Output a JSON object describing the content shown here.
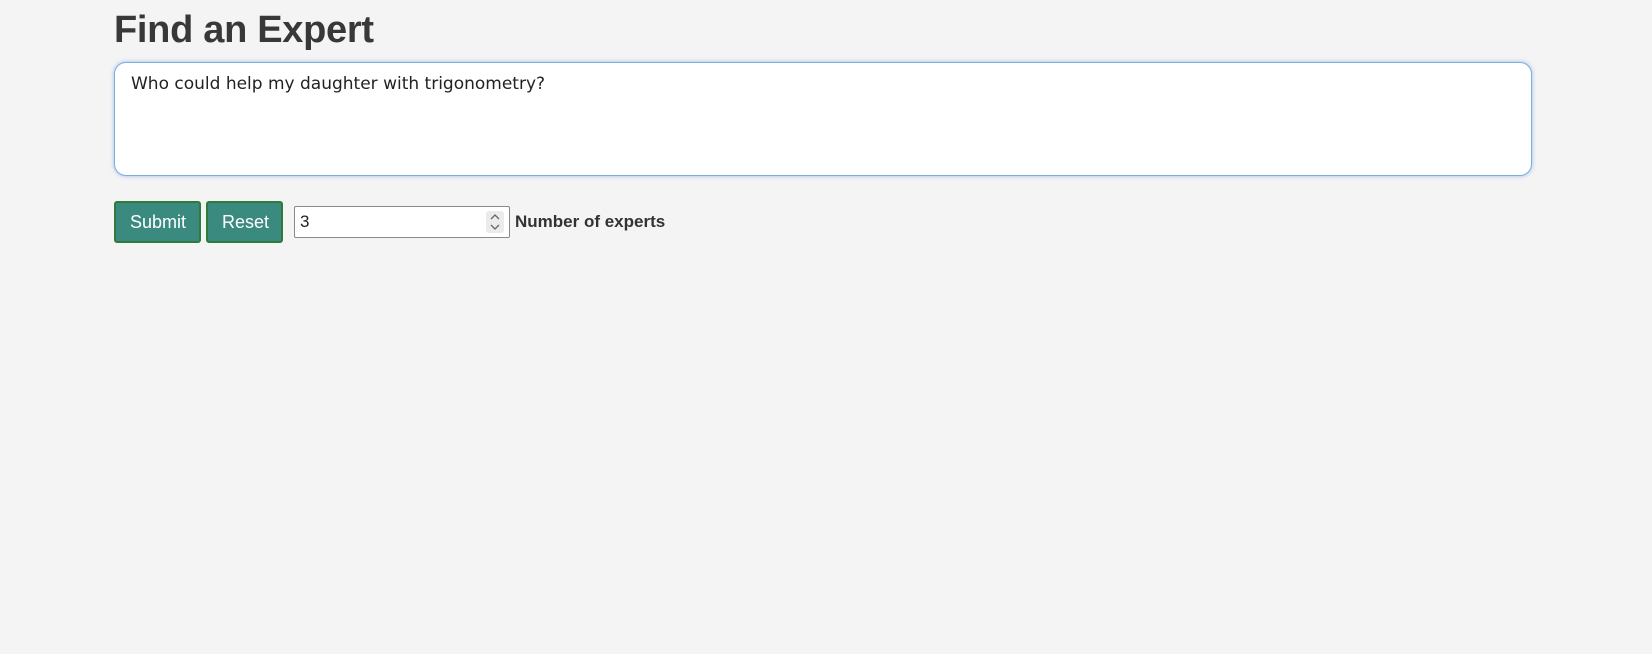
{
  "header": {
    "title": "Find an Expert"
  },
  "query": {
    "value": "Who could help my daughter with trigonometry?"
  },
  "controls": {
    "submit_label": "Submit",
    "reset_label": "Reset",
    "num_experts_value": "3",
    "num_experts_label": "Number of experts"
  },
  "icons": {
    "stepper": "chevron-up-down-icon"
  },
  "colors": {
    "button_bg": "#3a8a80",
    "button_border": "#2f7b3e",
    "focus_ring": "#7eaee0",
    "page_bg": "#f4f4f4"
  }
}
